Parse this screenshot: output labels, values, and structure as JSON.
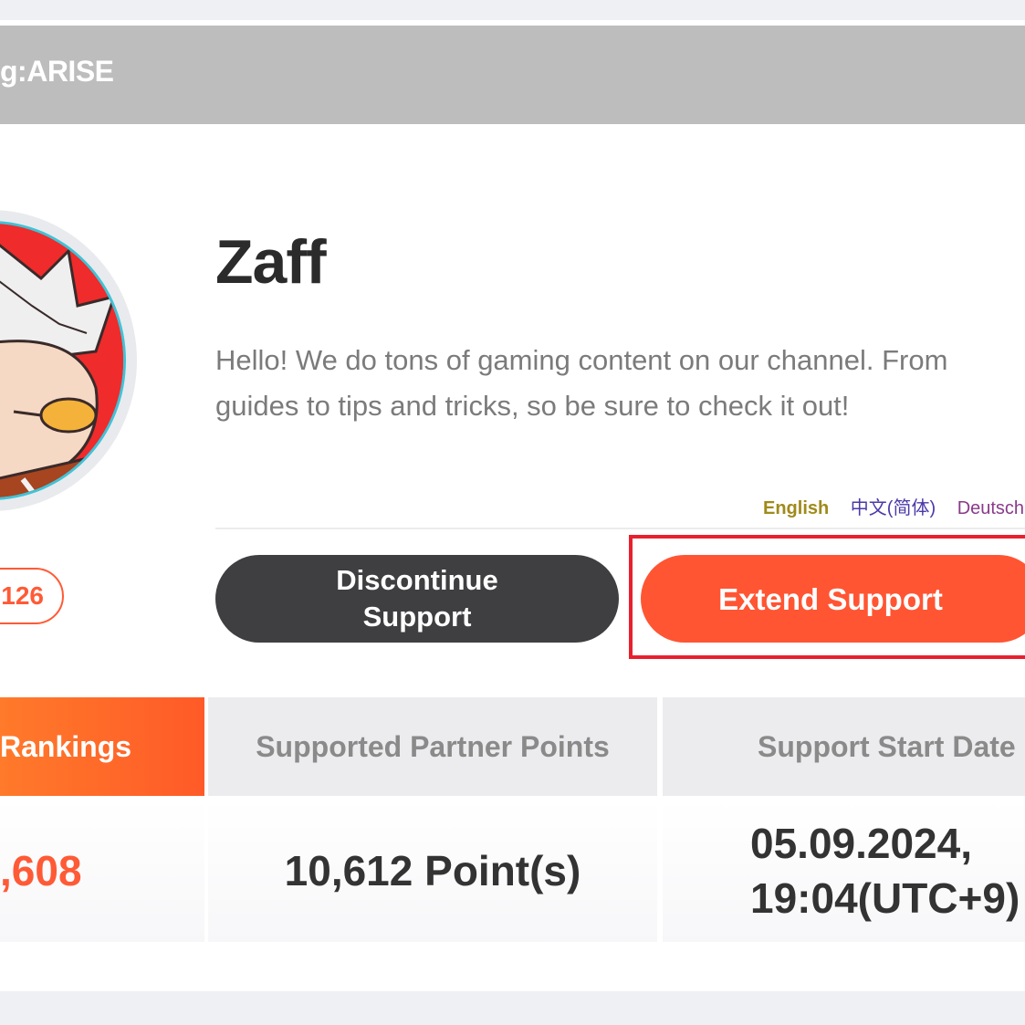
{
  "header": {
    "title": "g:ARISE"
  },
  "profile": {
    "name": "Zaff",
    "description_line1": "Hello! We do tons of gaming content on our channel. From",
    "description_line2": "guides to tips and tricks, so be sure to check it out!",
    "stat_pill": ",126"
  },
  "languages": [
    {
      "label": "English",
      "color": "#a08a1a"
    },
    {
      "label": "中文(简体)",
      "color": "#4a3aa8"
    },
    {
      "label": "Deutsch",
      "color": "#8a3a8a"
    }
  ],
  "buttons": {
    "discontinue_line1": "Discontinue",
    "discontinue_line2": "Support",
    "extend": "Extend Support"
  },
  "stats": {
    "headers": [
      "Rankings",
      "Supported Partner Points",
      "Support Start Date"
    ],
    "ranking_value": ",608",
    "points_value": "10,612 Point(s)",
    "start_date_line1": "05.09.2024,",
    "start_date_line2": "19:04(UTC+9)"
  },
  "colors": {
    "accent": "#ff5533",
    "dark_button": "#3f3f41",
    "highlight": "#e8202e",
    "header_bar": "#bdbdbd"
  }
}
